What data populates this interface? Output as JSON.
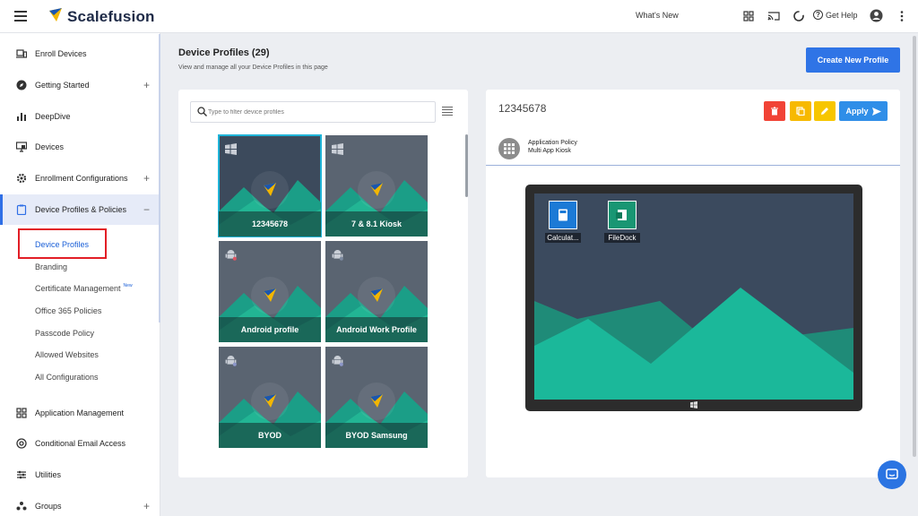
{
  "app": {
    "brand": "Scalefusion",
    "whats_new": "What's New",
    "get_help": "Get Help"
  },
  "sidebar": {
    "items": [
      {
        "label": "Enroll Devices",
        "icon": "devices-icon"
      },
      {
        "label": "Getting Started",
        "icon": "rocket-icon",
        "expand": "+"
      },
      {
        "label": "DeepDive",
        "icon": "bar-chart-icon"
      },
      {
        "label": "Devices",
        "icon": "monitor-icon"
      },
      {
        "label": "Enrollment Configurations",
        "icon": "cog-icon",
        "expand": "+"
      },
      {
        "label": "Device Profiles & Policies",
        "icon": "clipboard-icon",
        "expand": "−"
      },
      {
        "label": "Application Management",
        "icon": "apps-grid-icon"
      },
      {
        "label": "Conditional Email Access",
        "icon": "at-icon"
      },
      {
        "label": "Utilities",
        "icon": "sliders-icon"
      },
      {
        "label": "Groups",
        "icon": "groups-icon",
        "expand": "+"
      }
    ],
    "subitems": [
      "Device Profiles",
      "Branding",
      "Certificate Management",
      "Office 365 Policies",
      "Passcode Policy",
      "Allowed Websites",
      "All Configurations"
    ],
    "new_tag": "New"
  },
  "main": {
    "title": "Device Profiles (29)",
    "subtitle": "View and manage all your Device Profiles in this page",
    "create_button": "Create New Profile",
    "search_placeholder": "Type to filter device profiles",
    "profiles": [
      {
        "name": "12345678",
        "os": "windows"
      },
      {
        "name": "7 & 8.1 Kiosk",
        "os": "windows"
      },
      {
        "name": "Android profile",
        "os": "android"
      },
      {
        "name": "Android Work Profile",
        "os": "android"
      },
      {
        "name": "BYOD",
        "os": "android"
      },
      {
        "name": "BYOD Samsung",
        "os": "android"
      }
    ]
  },
  "detail": {
    "title": "12345678",
    "apply_label": "Apply",
    "policy_type": "Application Policy",
    "policy_name": "Multi App Kiosk",
    "apps": [
      {
        "label": "Calculat..."
      },
      {
        "label": "FileDock"
      }
    ],
    "colors": {
      "delete": "#f14336",
      "copy": "#f7b900",
      "edit": "#f7c600",
      "apply": "#2f8ee8"
    }
  }
}
